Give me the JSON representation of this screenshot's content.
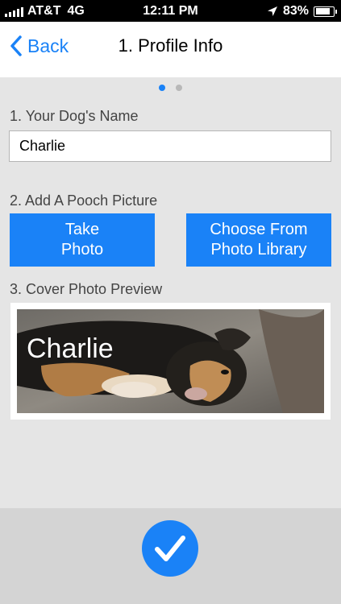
{
  "status_bar": {
    "carrier": "AT&T",
    "network": "4G",
    "time": "12:11 PM",
    "battery": "83%",
    "battery_level": 0.83,
    "icons": [
      "signal-bars-icon",
      "location-arrow-icon",
      "battery-icon"
    ]
  },
  "nav": {
    "back_label": "Back",
    "title": "1. Profile Info"
  },
  "page_indicator": {
    "pages": 2,
    "current": 1
  },
  "form": {
    "name_label": "1. Your Dog's Name",
    "name_value": "Charlie",
    "picture_label": "2. Add A Pooch Picture",
    "take_photo_label": "Take\nPhoto",
    "choose_library_label": "Choose From\nPhoto Library",
    "preview_label": "3. Cover Photo Preview",
    "cover_name": "Charlie"
  },
  "colors": {
    "accent": "#1a82f7",
    "background": "#e5e5e5",
    "bottom_bar": "#d4d4d4"
  },
  "bottom": {
    "confirm_icon": "checkmark-icon"
  }
}
